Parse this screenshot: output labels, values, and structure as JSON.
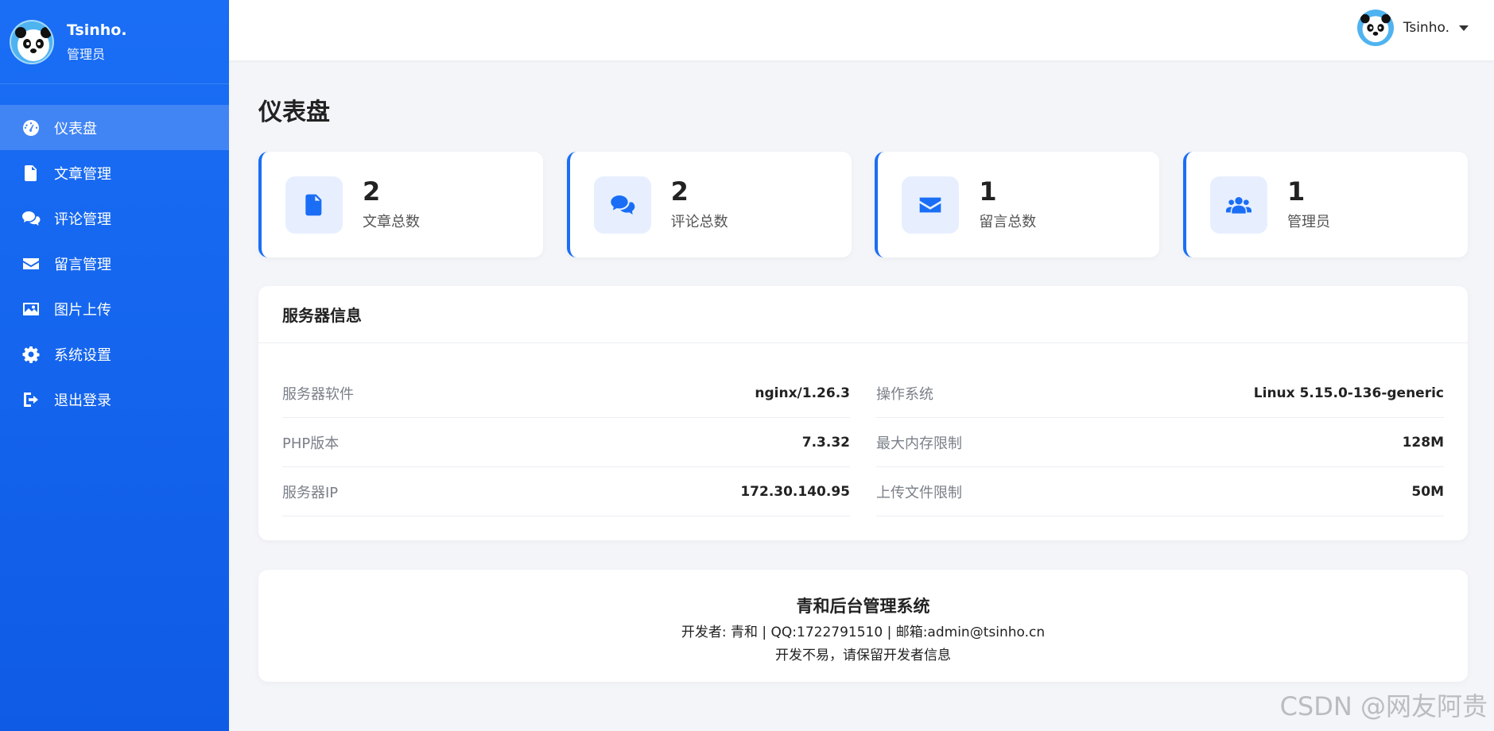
{
  "sidebar": {
    "user_name": "Tsinho.",
    "user_role": "管理员",
    "items": [
      {
        "label": "仪表盘",
        "icon": "dashboard-icon",
        "active": true
      },
      {
        "label": "文章管理",
        "icon": "file-icon"
      },
      {
        "label": "评论管理",
        "icon": "comments-icon"
      },
      {
        "label": "留言管理",
        "icon": "envelope-icon"
      },
      {
        "label": "图片上传",
        "icon": "image-icon"
      },
      {
        "label": "系统设置",
        "icon": "gear-icon"
      },
      {
        "label": "退出登录",
        "icon": "sign-out-icon"
      }
    ]
  },
  "topbar": {
    "user_name": "Tsinho."
  },
  "page_title": "仪表盘",
  "stats": [
    {
      "value": "2",
      "label": "文章总数",
      "icon": "file-icon"
    },
    {
      "value": "2",
      "label": "评论总数",
      "icon": "comments-icon"
    },
    {
      "value": "1",
      "label": "留言总数",
      "icon": "envelope-icon"
    },
    {
      "value": "1",
      "label": "管理员",
      "icon": "users-icon"
    }
  ],
  "server": {
    "title": "服务器信息",
    "left": [
      {
        "label": "服务器软件",
        "value": "nginx/1.26.3"
      },
      {
        "label": "PHP版本",
        "value": "7.3.32"
      },
      {
        "label": "服务器IP",
        "value": "172.30.140.95"
      }
    ],
    "right": [
      {
        "label": "操作系统",
        "value": "Linux 5.15.0-136-generic"
      },
      {
        "label": "最大内存限制",
        "value": "128M"
      },
      {
        "label": "上传文件限制",
        "value": "50M"
      }
    ]
  },
  "footer": {
    "title": "青和后台管理系统",
    "line1": "开发者: 青和 | QQ:1722791510 | 邮箱:admin@tsinho.cn",
    "line2": "开发不易，请保留开发者信息"
  },
  "watermark": "CSDN @网友阿贵",
  "colors": {
    "accent": "#1a6ef5",
    "sidebar": "#0f5be6",
    "background": "#f3f5f9"
  }
}
